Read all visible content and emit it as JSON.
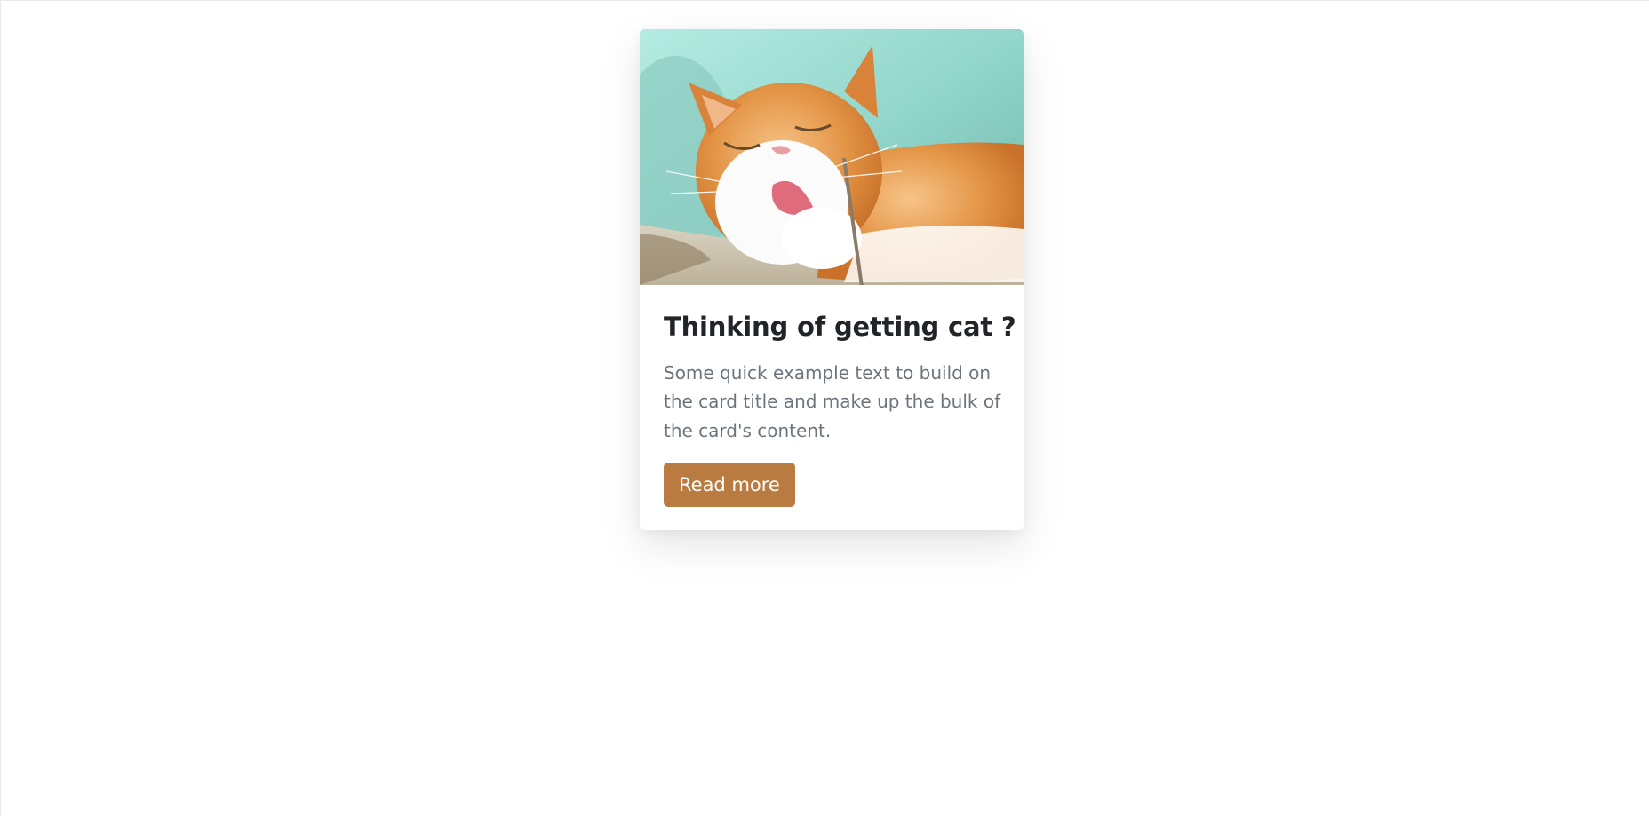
{
  "card": {
    "image_alt": "Orange and white cat licking its paw",
    "title": "Thinking of getting cat ?",
    "text": "Some quick example text to build on the card title and make up the bulk of the card's content.",
    "button_label": "Read more"
  },
  "colors": {
    "button": "#b97b3f",
    "title": "#212529",
    "text": "#6c757d",
    "image_background": "#9fdcd2"
  }
}
